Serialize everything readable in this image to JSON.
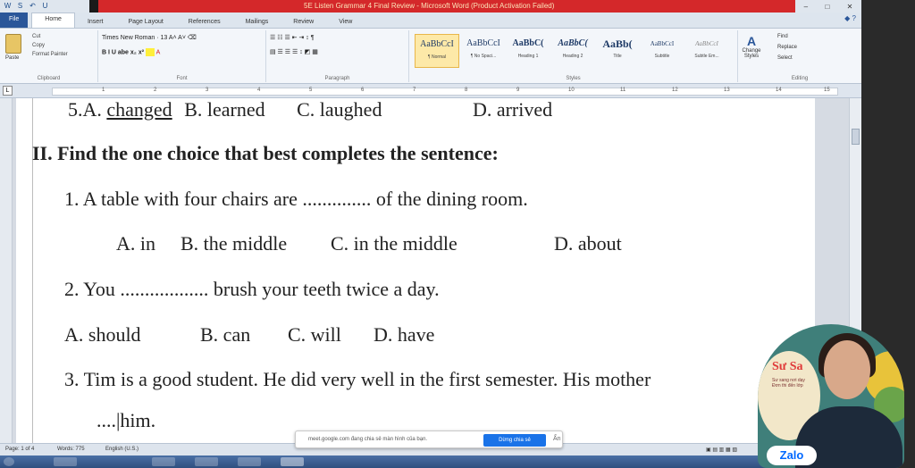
{
  "window": {
    "title": "5E Listen Grammar 4 Final Review - Microsoft Word (Product Activation Failed)",
    "quick_access": [
      "W",
      "S",
      "↶",
      "U"
    ],
    "controls": [
      "–",
      "□",
      "✕"
    ]
  },
  "ribbon": {
    "tabs": [
      "File",
      "Home",
      "Insert",
      "Page Layout",
      "References",
      "Mailings",
      "Review",
      "View"
    ],
    "active_tab": "Home",
    "clipboard": {
      "paste": "Paste",
      "cut": "Cut",
      "copy": "Copy",
      "format_painter": "Format Painter",
      "label": "Clipboard"
    },
    "font": {
      "name": "Times New Roman",
      "size": "13",
      "row2": "B  I  U  abe  x₂  x²",
      "label": "Font"
    },
    "paragraph": {
      "label": "Paragraph"
    },
    "styles": {
      "items": [
        {
          "sample": "AaBbCcI",
          "name": "¶ Normal"
        },
        {
          "sample": "AaBbCcI",
          "name": "¶ No Spaci..."
        },
        {
          "sample": "AaBbC(",
          "name": "Heading 1"
        },
        {
          "sample": "AaBbC(",
          "name": "Heading 2"
        },
        {
          "sample": "AaBb(",
          "name": "Title"
        },
        {
          "sample": "AaBbCcI",
          "name": "Subtitle"
        },
        {
          "sample": "AaBbCcI",
          "name": "Subtle Em..."
        }
      ],
      "change_styles": "Change Styles",
      "label": "Styles"
    },
    "editing": {
      "find": "Find",
      "replace": "Replace",
      "select": "Select",
      "label": "Editing"
    }
  },
  "ruler": {
    "numbers": [
      "1",
      "2",
      "3",
      "4",
      "5",
      "6",
      "7",
      "8",
      "9",
      "10",
      "11",
      "12",
      "13",
      "14",
      "15"
    ]
  },
  "document": {
    "q5": {
      "prefix": "5.A. ",
      "a": "changed",
      "b_prefix": "B. ",
      "b": "learned",
      "c_prefix": "C. ",
      "c": "laughed",
      "d_prefix": "D. ",
      "d": "arrived"
    },
    "section_heading": "II. Find the one choice that best completes the sentence:",
    "q1": {
      "text": "1.  A table with four chairs are .............. of the dining room.",
      "options": [
        "A. in",
        "B. the middle",
        "C. in the middle",
        "D. about"
      ]
    },
    "q2": {
      "text": "2.  You .................. brush your teeth twice a day.",
      "options": [
        "A. should",
        "B. can",
        "C. will",
        "D. have"
      ]
    },
    "q3": {
      "text": "3.  Tim is a good student. He did very well in the first semester. His mother",
      "continuation": "....|him."
    }
  },
  "statusbar": {
    "page": "Page: 1 of 4",
    "words": "Words: 775",
    "language": "English (U.S.)"
  },
  "notification": {
    "text": "meet.google.com đang chia sẻ màn hình của bạn.",
    "button": "Dừng chia sẻ",
    "close": "Ẩn"
  },
  "video": {
    "logo": "Sư Sa",
    "logo_sub": "Sư sang nơi dạy Đơn thi đến lớp",
    "app": "Zalo"
  }
}
